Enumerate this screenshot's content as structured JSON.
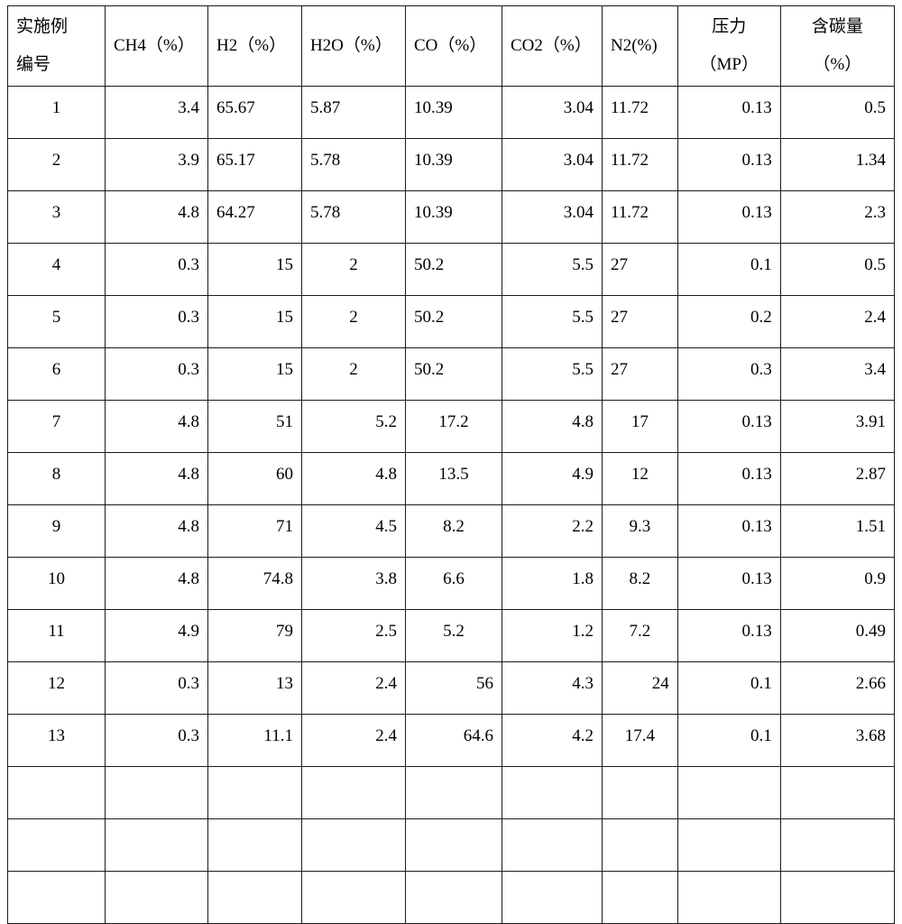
{
  "table": {
    "headers": [
      {
        "line1": "实施例",
        "line2": "编号",
        "align": "left"
      },
      {
        "line1": "CH4（%）",
        "line2": "",
        "align": "left"
      },
      {
        "line1": "H2（%）",
        "line2": "",
        "align": "left"
      },
      {
        "line1": "H2O（%）",
        "line2": "",
        "align": "left"
      },
      {
        "line1": "CO（%）",
        "line2": "",
        "align": "left"
      },
      {
        "line1": "CO2（%）",
        "line2": "",
        "align": "left"
      },
      {
        "line1": "N2(%)",
        "line2": "",
        "align": "left"
      },
      {
        "line1": "压力",
        "line2": "（MP）",
        "align": "center"
      },
      {
        "line1": "含碳量",
        "line2": "（%）",
        "align": "center"
      }
    ],
    "rows": [
      {
        "cells": [
          {
            "v": "1",
            "align": "center"
          },
          {
            "v": "3.4",
            "align": "right"
          },
          {
            "v": "65.67",
            "align": "left"
          },
          {
            "v": "5.87",
            "align": "left"
          },
          {
            "v": "10.39",
            "align": "left"
          },
          {
            "v": "3.04",
            "align": "right"
          },
          {
            "v": "11.72",
            "align": "left"
          },
          {
            "v": "0.13",
            "align": "right"
          },
          {
            "v": "0.5",
            "align": "right"
          }
        ]
      },
      {
        "cells": [
          {
            "v": "2",
            "align": "center"
          },
          {
            "v": "3.9",
            "align": "right"
          },
          {
            "v": "65.17",
            "align": "left"
          },
          {
            "v": "5.78",
            "align": "left"
          },
          {
            "v": "10.39",
            "align": "left"
          },
          {
            "v": "3.04",
            "align": "right"
          },
          {
            "v": "11.72",
            "align": "left"
          },
          {
            "v": "0.13",
            "align": "right"
          },
          {
            "v": "1.34",
            "align": "right"
          }
        ]
      },
      {
        "cells": [
          {
            "v": "3",
            "align": "center"
          },
          {
            "v": "4.8",
            "align": "right"
          },
          {
            "v": "64.27",
            "align": "left"
          },
          {
            "v": "5.78",
            "align": "left"
          },
          {
            "v": "10.39",
            "align": "left"
          },
          {
            "v": "3.04",
            "align": "right"
          },
          {
            "v": "11.72",
            "align": "left"
          },
          {
            "v": "0.13",
            "align": "right"
          },
          {
            "v": "2.3",
            "align": "right"
          }
        ]
      },
      {
        "cells": [
          {
            "v": "4",
            "align": "center"
          },
          {
            "v": "0.3",
            "align": "right"
          },
          {
            "v": "15",
            "align": "right"
          },
          {
            "v": "2",
            "align": "center"
          },
          {
            "v": "50.2",
            "align": "left"
          },
          {
            "v": "5.5",
            "align": "right"
          },
          {
            "v": "27",
            "align": "left"
          },
          {
            "v": "0.1",
            "align": "right"
          },
          {
            "v": "0.5",
            "align": "right"
          }
        ]
      },
      {
        "cells": [
          {
            "v": "5",
            "align": "center"
          },
          {
            "v": "0.3",
            "align": "right"
          },
          {
            "v": "15",
            "align": "right"
          },
          {
            "v": "2",
            "align": "center"
          },
          {
            "v": "50.2",
            "align": "left"
          },
          {
            "v": "5.5",
            "align": "right"
          },
          {
            "v": "27",
            "align": "left"
          },
          {
            "v": "0.2",
            "align": "right"
          },
          {
            "v": "2.4",
            "align": "right"
          }
        ]
      },
      {
        "cells": [
          {
            "v": "6",
            "align": "center"
          },
          {
            "v": "0.3",
            "align": "right"
          },
          {
            "v": "15",
            "align": "right"
          },
          {
            "v": "2",
            "align": "center"
          },
          {
            "v": "50.2",
            "align": "left"
          },
          {
            "v": "5.5",
            "align": "right"
          },
          {
            "v": "27",
            "align": "left"
          },
          {
            "v": "0.3",
            "align": "right"
          },
          {
            "v": "3.4",
            "align": "right"
          }
        ]
      },
      {
        "cells": [
          {
            "v": "7",
            "align": "center"
          },
          {
            "v": "4.8",
            "align": "right"
          },
          {
            "v": "51",
            "align": "right"
          },
          {
            "v": "5.2",
            "align": "right"
          },
          {
            "v": "17.2",
            "align": "center"
          },
          {
            "v": "4.8",
            "align": "right"
          },
          {
            "v": "17",
            "align": "center"
          },
          {
            "v": "0.13",
            "align": "right"
          },
          {
            "v": "3.91",
            "align": "right"
          }
        ]
      },
      {
        "cells": [
          {
            "v": "8",
            "align": "center"
          },
          {
            "v": "4.8",
            "align": "right"
          },
          {
            "v": "60",
            "align": "right"
          },
          {
            "v": "4.8",
            "align": "right"
          },
          {
            "v": "13.5",
            "align": "center"
          },
          {
            "v": "4.9",
            "align": "right"
          },
          {
            "v": "12",
            "align": "center"
          },
          {
            "v": "0.13",
            "align": "right"
          },
          {
            "v": "2.87",
            "align": "right"
          }
        ]
      },
      {
        "cells": [
          {
            "v": "9",
            "align": "center"
          },
          {
            "v": "4.8",
            "align": "right"
          },
          {
            "v": "71",
            "align": "right"
          },
          {
            "v": "4.5",
            "align": "right"
          },
          {
            "v": "8.2",
            "align": "center"
          },
          {
            "v": "2.2",
            "align": "right"
          },
          {
            "v": "9.3",
            "align": "center"
          },
          {
            "v": "0.13",
            "align": "right"
          },
          {
            "v": "1.51",
            "align": "right"
          }
        ]
      },
      {
        "cells": [
          {
            "v": "10",
            "align": "center"
          },
          {
            "v": "4.8",
            "align": "right"
          },
          {
            "v": "74.8",
            "align": "right"
          },
          {
            "v": "3.8",
            "align": "right"
          },
          {
            "v": "6.6",
            "align": "center"
          },
          {
            "v": "1.8",
            "align": "right"
          },
          {
            "v": "8.2",
            "align": "center"
          },
          {
            "v": "0.13",
            "align": "right"
          },
          {
            "v": "0.9",
            "align": "right"
          }
        ]
      },
      {
        "cells": [
          {
            "v": "11",
            "align": "center"
          },
          {
            "v": "4.9",
            "align": "right"
          },
          {
            "v": "79",
            "align": "right"
          },
          {
            "v": "2.5",
            "align": "right"
          },
          {
            "v": "5.2",
            "align": "center"
          },
          {
            "v": "1.2",
            "align": "right"
          },
          {
            "v": "7.2",
            "align": "center"
          },
          {
            "v": "0.13",
            "align": "right"
          },
          {
            "v": "0.49",
            "align": "right"
          }
        ]
      },
      {
        "cells": [
          {
            "v": "12",
            "align": "center"
          },
          {
            "v": "0.3",
            "align": "right"
          },
          {
            "v": "13",
            "align": "right"
          },
          {
            "v": "2.4",
            "align": "right"
          },
          {
            "v": "56",
            "align": "right"
          },
          {
            "v": "4.3",
            "align": "right"
          },
          {
            "v": "24",
            "align": "right"
          },
          {
            "v": "0.1",
            "align": "right"
          },
          {
            "v": "2.66",
            "align": "right"
          }
        ]
      },
      {
        "cells": [
          {
            "v": "13",
            "align": "center"
          },
          {
            "v": "0.3",
            "align": "right"
          },
          {
            "v": "11.1",
            "align": "right"
          },
          {
            "v": "2.4",
            "align": "right"
          },
          {
            "v": "64.6",
            "align": "right"
          },
          {
            "v": "4.2",
            "align": "right"
          },
          {
            "v": "17.4",
            "align": "center"
          },
          {
            "v": "0.1",
            "align": "right"
          },
          {
            "v": "3.68",
            "align": "right"
          }
        ]
      },
      {
        "cells": [
          {
            "v": "",
            "align": "center"
          },
          {
            "v": "",
            "align": "right"
          },
          {
            "v": "",
            "align": "right"
          },
          {
            "v": "",
            "align": "right"
          },
          {
            "v": "",
            "align": "right"
          },
          {
            "v": "",
            "align": "right"
          },
          {
            "v": "",
            "align": "right"
          },
          {
            "v": "",
            "align": "right"
          },
          {
            "v": "",
            "align": "right"
          }
        ]
      },
      {
        "cells": [
          {
            "v": "",
            "align": "center"
          },
          {
            "v": "",
            "align": "right"
          },
          {
            "v": "",
            "align": "right"
          },
          {
            "v": "",
            "align": "right"
          },
          {
            "v": "",
            "align": "right"
          },
          {
            "v": "",
            "align": "right"
          },
          {
            "v": "",
            "align": "right"
          },
          {
            "v": "",
            "align": "right"
          },
          {
            "v": "",
            "align": "right"
          }
        ]
      },
      {
        "cells": [
          {
            "v": "",
            "align": "center"
          },
          {
            "v": "",
            "align": "right"
          },
          {
            "v": "",
            "align": "right"
          },
          {
            "v": "",
            "align": "right"
          },
          {
            "v": "",
            "align": "right"
          },
          {
            "v": "",
            "align": "right"
          },
          {
            "v": "",
            "align": "right"
          },
          {
            "v": "",
            "align": "right"
          },
          {
            "v": "",
            "align": "right"
          }
        ]
      }
    ]
  },
  "colors": {
    "border": "#1a1a1a",
    "text": "#000000",
    "background": "#ffffff"
  }
}
